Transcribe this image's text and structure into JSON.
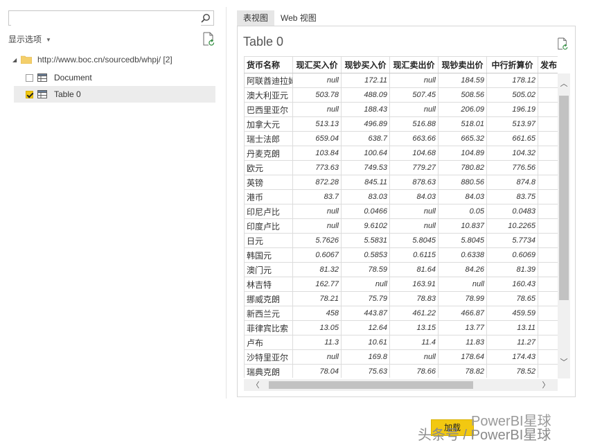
{
  "navigator": {
    "search": {
      "value": "",
      "placeholder": ""
    },
    "display_options": "显示选项",
    "root": {
      "label": "http://www.boc.cn/sourcedb/whpj/ [2]"
    },
    "items": [
      {
        "label": "Document",
        "checked": false
      },
      {
        "label": "Table 0",
        "checked": true
      }
    ]
  },
  "preview": {
    "tabs": [
      "表视图",
      "Web 视图"
    ],
    "title": "Table 0",
    "columns": [
      "货币名称",
      "现汇买入价",
      "现钞买入价",
      "现汇卖出价",
      "现钞卖出价",
      "中行折算价",
      "发布日期"
    ],
    "rows": [
      [
        "阿联酋迪拉姆",
        "null",
        "172.11",
        "null",
        "184.59",
        "178.12",
        ""
      ],
      [
        "澳大利亚元",
        "503.78",
        "488.09",
        "507.45",
        "508.56",
        "505.02",
        ""
      ],
      [
        "巴西里亚尔",
        "null",
        "188.43",
        "null",
        "206.09",
        "196.19",
        ""
      ],
      [
        "加拿大元",
        "513.13",
        "496.89",
        "516.88",
        "518.01",
        "513.97",
        ""
      ],
      [
        "瑞士法郎",
        "659.04",
        "638.7",
        "663.66",
        "665.32",
        "661.65",
        ""
      ],
      [
        "丹麦克朗",
        "103.84",
        "100.64",
        "104.68",
        "104.89",
        "104.32",
        ""
      ],
      [
        "欧元",
        "773.63",
        "749.53",
        "779.27",
        "780.82",
        "776.56",
        ""
      ],
      [
        "英镑",
        "872.28",
        "845.11",
        "878.63",
        "880.56",
        "874.8",
        ""
      ],
      [
        "港币",
        "83.7",
        "83.03",
        "84.03",
        "84.03",
        "83.75",
        ""
      ],
      [
        "印尼卢比",
        "null",
        "0.0466",
        "null",
        "0.05",
        "0.0483",
        ""
      ],
      [
        "印度卢比",
        "null",
        "9.6102",
        "null",
        "10.837",
        "10.2265",
        ""
      ],
      [
        "日元",
        "5.7626",
        "5.5831",
        "5.8045",
        "5.8045",
        "5.7734",
        ""
      ],
      [
        "韩国元",
        "0.6067",
        "0.5853",
        "0.6115",
        "0.6338",
        "0.6069",
        ""
      ],
      [
        "澳门元",
        "81.32",
        "78.59",
        "81.64",
        "84.26",
        "81.39",
        ""
      ],
      [
        "林吉特",
        "162.77",
        "null",
        "163.91",
        "null",
        "160.43",
        ""
      ],
      [
        "挪威克朗",
        "78.21",
        "75.79",
        "78.83",
        "78.99",
        "78.65",
        ""
      ],
      [
        "新西兰元",
        "458",
        "443.87",
        "461.22",
        "466.87",
        "459.59",
        ""
      ],
      [
        "菲律宾比索",
        "13.05",
        "12.64",
        "13.15",
        "13.77",
        "13.11",
        ""
      ],
      [
        "卢布",
        "11.3",
        "10.61",
        "11.4",
        "11.83",
        "11.27",
        ""
      ],
      [
        "沙特里亚尔",
        "null",
        "169.8",
        "null",
        "178.64",
        "174.43",
        ""
      ],
      [
        "瑞典克朗",
        "78.04",
        "75.63",
        "78.66",
        "78.82",
        "78.52",
        ""
      ]
    ]
  },
  "footer": {
    "load_label": "加载"
  },
  "watermark": {
    "line1": "PowerBI星球",
    "line2": "头条号 / PowerBI星球"
  },
  "colors": {
    "accent": "#f2c811",
    "scroll_thumb": "#c2c2c2"
  }
}
